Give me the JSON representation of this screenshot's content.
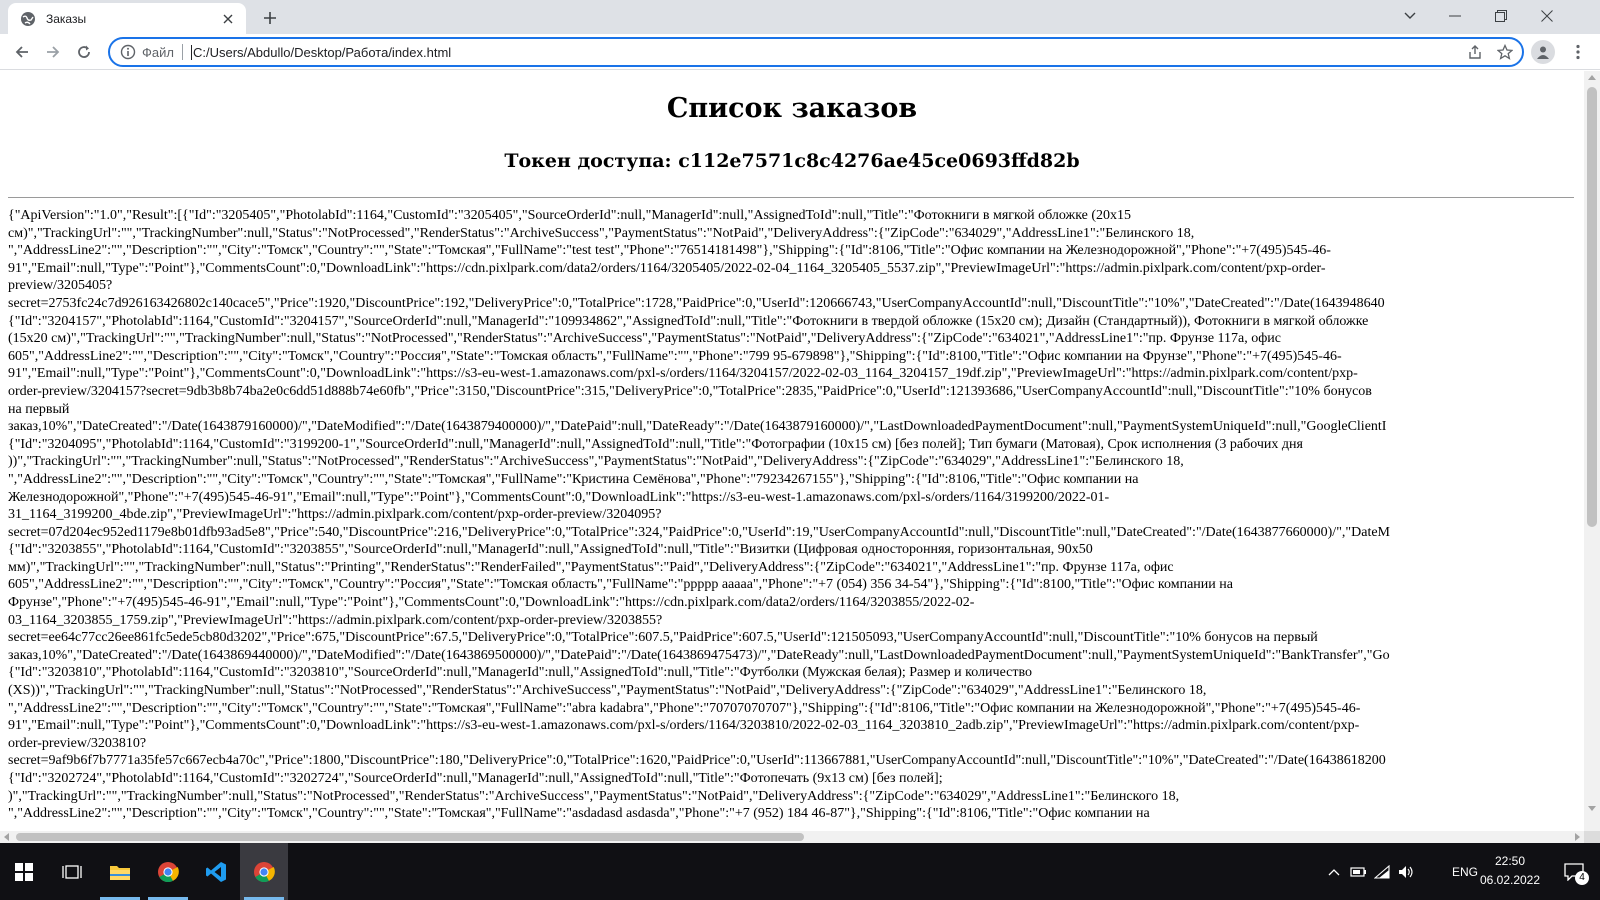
{
  "browser": {
    "tab_title": "Заказы",
    "scheme_label": "Файл",
    "url": "C:/Users/Abdullo/Desktop/Работа/index.html"
  },
  "page": {
    "title": "Список заказов",
    "subtitle": "Токен доступа: c112e7571c8c4276ae45ce0693ffd82b",
    "json_lines": [
      "{\"ApiVersion\":\"1.0\",\"Result\":[{\"Id\":\"3205405\",\"PhotolabId\":1164,\"CustomId\":\"3205405\",\"SourceOrderId\":null,\"ManagerId\":null,\"AssignedToId\":null,\"Title\":\"Фотокниги в мягкой обложке (20x15",
      "см)\",\"TrackingUrl\":\"\",\"TrackingNumber\":null,\"Status\":\"NotProcessed\",\"RenderStatus\":\"ArchiveSuccess\",\"PaymentStatus\":\"NotPaid\",\"DeliveryAddress\":{\"ZipCode\":\"634029\",\"AddressLine1\":\"Белинского 18,",
      "\",\"AddressLine2\":\"\",\"Description\":\"\",\"City\":\"Томск\",\"Country\":\"\",\"State\":\"Томская\",\"FullName\":\"test test\",\"Phone\":\"76514181498\"},\"Shipping\":{\"Id\":8106,\"Title\":\"Офис компании на Железнодорожной\",\"Phone\":\"+7(495)545-46-",
      "91\",\"Email\":null,\"Type\":\"Point\"},\"CommentsCount\":0,\"DownloadLink\":\"https://cdn.pixlpark.com/data2/orders/1164/3205405/2022-02-04_1164_3205405_5537.zip\",\"PreviewImageUrl\":\"https://admin.pixlpark.com/content/pxp-order-",
      "preview/3205405?",
      "secret=2753fc24c7d926163426802c140cace5\",\"Price\":1920,\"DiscountPrice\":192,\"DeliveryPrice\":0,\"TotalPrice\":1728,\"PaidPrice\":0,\"UserId\":120666743,\"UserCompanyAccountId\":null,\"DiscountTitle\":\"10%\",\"DateCreated\":\"/Date(1643948640",
      "{\"Id\":\"3204157\",\"PhotolabId\":1164,\"CustomId\":\"3204157\",\"SourceOrderId\":null,\"ManagerId\":\"109934862\",\"AssignedToId\":null,\"Title\":\"Фотокниги в твердой обложке (15x20 см); Дизайн (Стандартный)), Фотокниги в мягкой обложке",
      "(15x20 см)\",\"TrackingUrl\":\"\",\"TrackingNumber\":null,\"Status\":\"NotProcessed\",\"RenderStatus\":\"ArchiveSuccess\",\"PaymentStatus\":\"NotPaid\",\"DeliveryAddress\":{\"ZipCode\":\"634021\",\"AddressLine1\":\"пр. Фрунзе 117а, офис",
      "605\",\"AddressLine2\":\"\",\"Description\":\"\",\"City\":\"Томск\",\"Country\":\"Россия\",\"State\":\"Томская область\",\"FullName\":\"\",\"Phone\":\"799 95-679898\"},\"Shipping\":{\"Id\":8100,\"Title\":\"Офис компании на Фрунзе\",\"Phone\":\"+7(495)545-46-",
      "91\",\"Email\":null,\"Type\":\"Point\"},\"CommentsCount\":0,\"DownloadLink\":\"https://s3-eu-west-1.amazonaws.com/pxl-s/orders/1164/3204157/2022-02-03_1164_3204157_19df.zip\",\"PreviewImageUrl\":\"https://admin.pixlpark.com/content/pxp-",
      "order-preview/3204157?secret=9db3b8b74ba2e0c6dd51d888b74e60fb\",\"Price\":3150,\"DiscountPrice\":315,\"DeliveryPrice\":0,\"TotalPrice\":2835,\"PaidPrice\":0,\"UserId\":121393686,\"UserCompanyAccountId\":null,\"DiscountTitle\":\"10% бонусов",
      "на первый",
      "заказ,10%\",\"DateCreated\":\"/Date(1643879160000)/\",\"DateModified\":\"/Date(1643879400000)/\",\"DatePaid\":null,\"DateReady\":\"/Date(1643879160000)/\",\"LastDownloadedPaymentDocument\":null,\"PaymentSystemUniqueId\":null,\"GoogleClientI",
      "{\"Id\":\"3204095\",\"PhotolabId\":1164,\"CustomId\":\"3199200-1\",\"SourceOrderId\":null,\"ManagerId\":null,\"AssignedToId\":null,\"Title\":\"Фотографии (10x15 см) [без полей]; Тип бумаги (Матовая), Срок исполнения (3 рабочих дня",
      "))\",\"TrackingUrl\":\"\",\"TrackingNumber\":null,\"Status\":\"NotProcessed\",\"RenderStatus\":\"ArchiveSuccess\",\"PaymentStatus\":\"NotPaid\",\"DeliveryAddress\":{\"ZipCode\":\"634029\",\"AddressLine1\":\"Белинского 18,",
      "\",\"AddressLine2\":\"\",\"Description\":\"\",\"City\":\"Томск\",\"Country\":\"\",\"State\":\"Томская\",\"FullName\":\"Кристина Семёнова\",\"Phone\":\"79234267155\"},\"Shipping\":{\"Id\":8106,\"Title\":\"Офис компании на",
      "Железнодорожной\",\"Phone\":\"+7(495)545-46-91\",\"Email\":null,\"Type\":\"Point\"},\"CommentsCount\":0,\"DownloadLink\":\"https://s3-eu-west-1.amazonaws.com/pxl-s/orders/1164/3199200/2022-01-",
      "31_1164_3199200_4bde.zip\",\"PreviewImageUrl\":\"https://admin.pixlpark.com/content/pxp-order-preview/3204095?",
      "secret=07d204ec952ed1179e8b01dfb93ad5e8\",\"Price\":540,\"DiscountPrice\":216,\"DeliveryPrice\":0,\"TotalPrice\":324,\"PaidPrice\":0,\"UserId\":19,\"UserCompanyAccountId\":null,\"DiscountTitle\":null,\"DateCreated\":\"/Date(1643877660000)/\",\"DateM",
      "{\"Id\":\"3203855\",\"PhotolabId\":1164,\"CustomId\":\"3203855\",\"SourceOrderId\":null,\"ManagerId\":null,\"AssignedToId\":null,\"Title\":\"Визитки (Цифровая односторонняя, горизонтальная, 90x50",
      "мм)\",\"TrackingUrl\":\"\",\"TrackingNumber\":null,\"Status\":\"Printing\",\"RenderStatus\":\"RenderFailed\",\"PaymentStatus\":\"Paid\",\"DeliveryAddress\":{\"ZipCode\":\"634021\",\"AddressLine1\":\"пр. Фрунзе 117а, офис",
      "605\",\"AddressLine2\":\"\",\"Description\":\"\",\"City\":\"Томск\",\"Country\":\"Россия\",\"State\":\"Томская область\",\"FullName\":\"ppppp aaaaa\",\"Phone\":\"+7 (054) 356 34-54\"},\"Shipping\":{\"Id\":8100,\"Title\":\"Офис компании на",
      "Фрунзе\",\"Phone\":\"+7(495)545-46-91\",\"Email\":null,\"Type\":\"Point\"},\"CommentsCount\":0,\"DownloadLink\":\"https://cdn.pixlpark.com/data2/orders/1164/3203855/2022-02-",
      "03_1164_3203855_1759.zip\",\"PreviewImageUrl\":\"https://admin.pixlpark.com/content/pxp-order-preview/3203855?",
      "secret=ee64c77cc26ee861fc5ede5cb80d3202\",\"Price\":675,\"DiscountPrice\":67.5,\"DeliveryPrice\":0,\"TotalPrice\":607.5,\"PaidPrice\":607.5,\"UserId\":121505093,\"UserCompanyAccountId\":null,\"DiscountTitle\":\"10% бонусов на первый",
      "заказ,10%\",\"DateCreated\":\"/Date(1643869440000)/\",\"DateModified\":\"/Date(1643869500000)/\",\"DatePaid\":\"/Date(1643869475473)/\",\"DateReady\":null,\"LastDownloadedPaymentDocument\":null,\"PaymentSystemUniqueId\":\"BankTransfer\",\"Go",
      "{\"Id\":\"3203810\",\"PhotolabId\":1164,\"CustomId\":\"3203810\",\"SourceOrderId\":null,\"ManagerId\":null,\"AssignedToId\":null,\"Title\":\"Футболки (Мужская белая); Размер и количество",
      "(XS))\",\"TrackingUrl\":\"\",\"TrackingNumber\":null,\"Status\":\"NotProcessed\",\"RenderStatus\":\"ArchiveSuccess\",\"PaymentStatus\":\"NotPaid\",\"DeliveryAddress\":{\"ZipCode\":\"634029\",\"AddressLine1\":\"Белинского 18,",
      "\",\"AddressLine2\":\"\",\"Description\":\"\",\"City\":\"Томск\",\"Country\":\"\",\"State\":\"Томская\",\"FullName\":\"abra kadabra\",\"Phone\":\"70707070707\"},\"Shipping\":{\"Id\":8106,\"Title\":\"Офис компании на Железнодорожной\",\"Phone\":\"+7(495)545-46-",
      "91\",\"Email\":null,\"Type\":\"Point\"},\"CommentsCount\":0,\"DownloadLink\":\"https://s3-eu-west-1.amazonaws.com/pxl-s/orders/1164/3203810/2022-02-03_1164_3203810_2adb.zip\",\"PreviewImageUrl\":\"https://admin.pixlpark.com/content/pxp-",
      "order-preview/3203810?",
      "secret=9af9b6f7b7771a35fe57c667ecb4a70c\",\"Price\":1800,\"DiscountPrice\":180,\"DeliveryPrice\":0,\"TotalPrice\":1620,\"PaidPrice\":0,\"UserId\":113667881,\"UserCompanyAccountId\":null,\"DiscountTitle\":\"10%\",\"DateCreated\":\"/Date(16438618200",
      "{\"Id\":\"3202724\",\"PhotolabId\":1164,\"CustomId\":\"3202724\",\"SourceOrderId\":null,\"ManagerId\":null,\"AssignedToId\":null,\"Title\":\"Фотопечать (9x13 см) [без полей];",
      ")\",\"TrackingUrl\":\"\",\"TrackingNumber\":null,\"Status\":\"NotProcessed\",\"RenderStatus\":\"ArchiveSuccess\",\"PaymentStatus\":\"NotPaid\",\"DeliveryAddress\":{\"ZipCode\":\"634029\",\"AddressLine1\":\"Белинского 18,",
      "\",\"AddressLine2\":\"\",\"Description\":\"\",\"City\":\"Томск\",\"Country\":\"\",\"State\":\"Томская\",\"FullName\":\"asdadasd asdasda\",\"Phone\":\"+7 (952) 184 46-87\"},\"Shipping\":{\"Id\":8106,\"Title\":\"Офис компании на"
    ]
  },
  "taskbar": {
    "language": "ENG",
    "time": "22:50",
    "date": "06.02.2022",
    "notification_count": "4"
  },
  "colors": {
    "accent": "#1a73e8",
    "tab_strip": "#dee1e6",
    "taskbar": "#101014"
  }
}
